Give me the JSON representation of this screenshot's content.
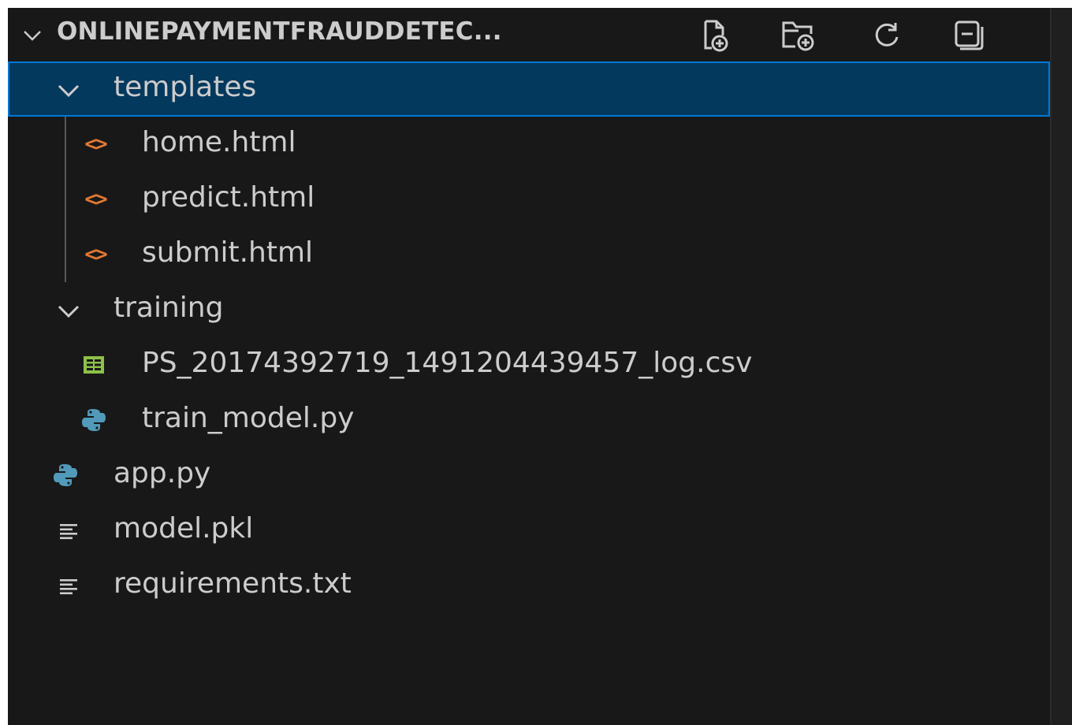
{
  "explorer": {
    "title": "ONLINEPAYMENTFRAUDDETEC...",
    "actions": [
      {
        "icon": "new-file-icon"
      },
      {
        "icon": "new-folder-icon"
      },
      {
        "icon": "refresh-icon"
      },
      {
        "icon": "collapse-all-icon"
      }
    ],
    "tree": {
      "templates": {
        "label": "templates",
        "files": [
          {
            "label": "home.html",
            "icon": "html-file-icon"
          },
          {
            "label": "predict.html",
            "icon": "html-file-icon"
          },
          {
            "label": "submit.html",
            "icon": "html-file-icon"
          }
        ]
      },
      "training": {
        "label": "training",
        "files": [
          {
            "label": "PS_20174392719_1491204439457_log.csv",
            "icon": "csv-file-icon"
          },
          {
            "label": "train_model.py",
            "icon": "python-file-icon"
          }
        ]
      },
      "root_files": [
        {
          "label": "app.py",
          "icon": "python-file-icon"
        },
        {
          "label": "model.pkl",
          "icon": "text-file-icon"
        },
        {
          "label": "requirements.txt",
          "icon": "text-file-icon"
        }
      ]
    }
  },
  "colors": {
    "background": "#181818",
    "selection": "#04395e",
    "focus_border": "#0078d4",
    "html_icon": "#e37933",
    "csv_icon": "#8dc149",
    "python_icon": "#519aba",
    "text": "#cccccc"
  }
}
